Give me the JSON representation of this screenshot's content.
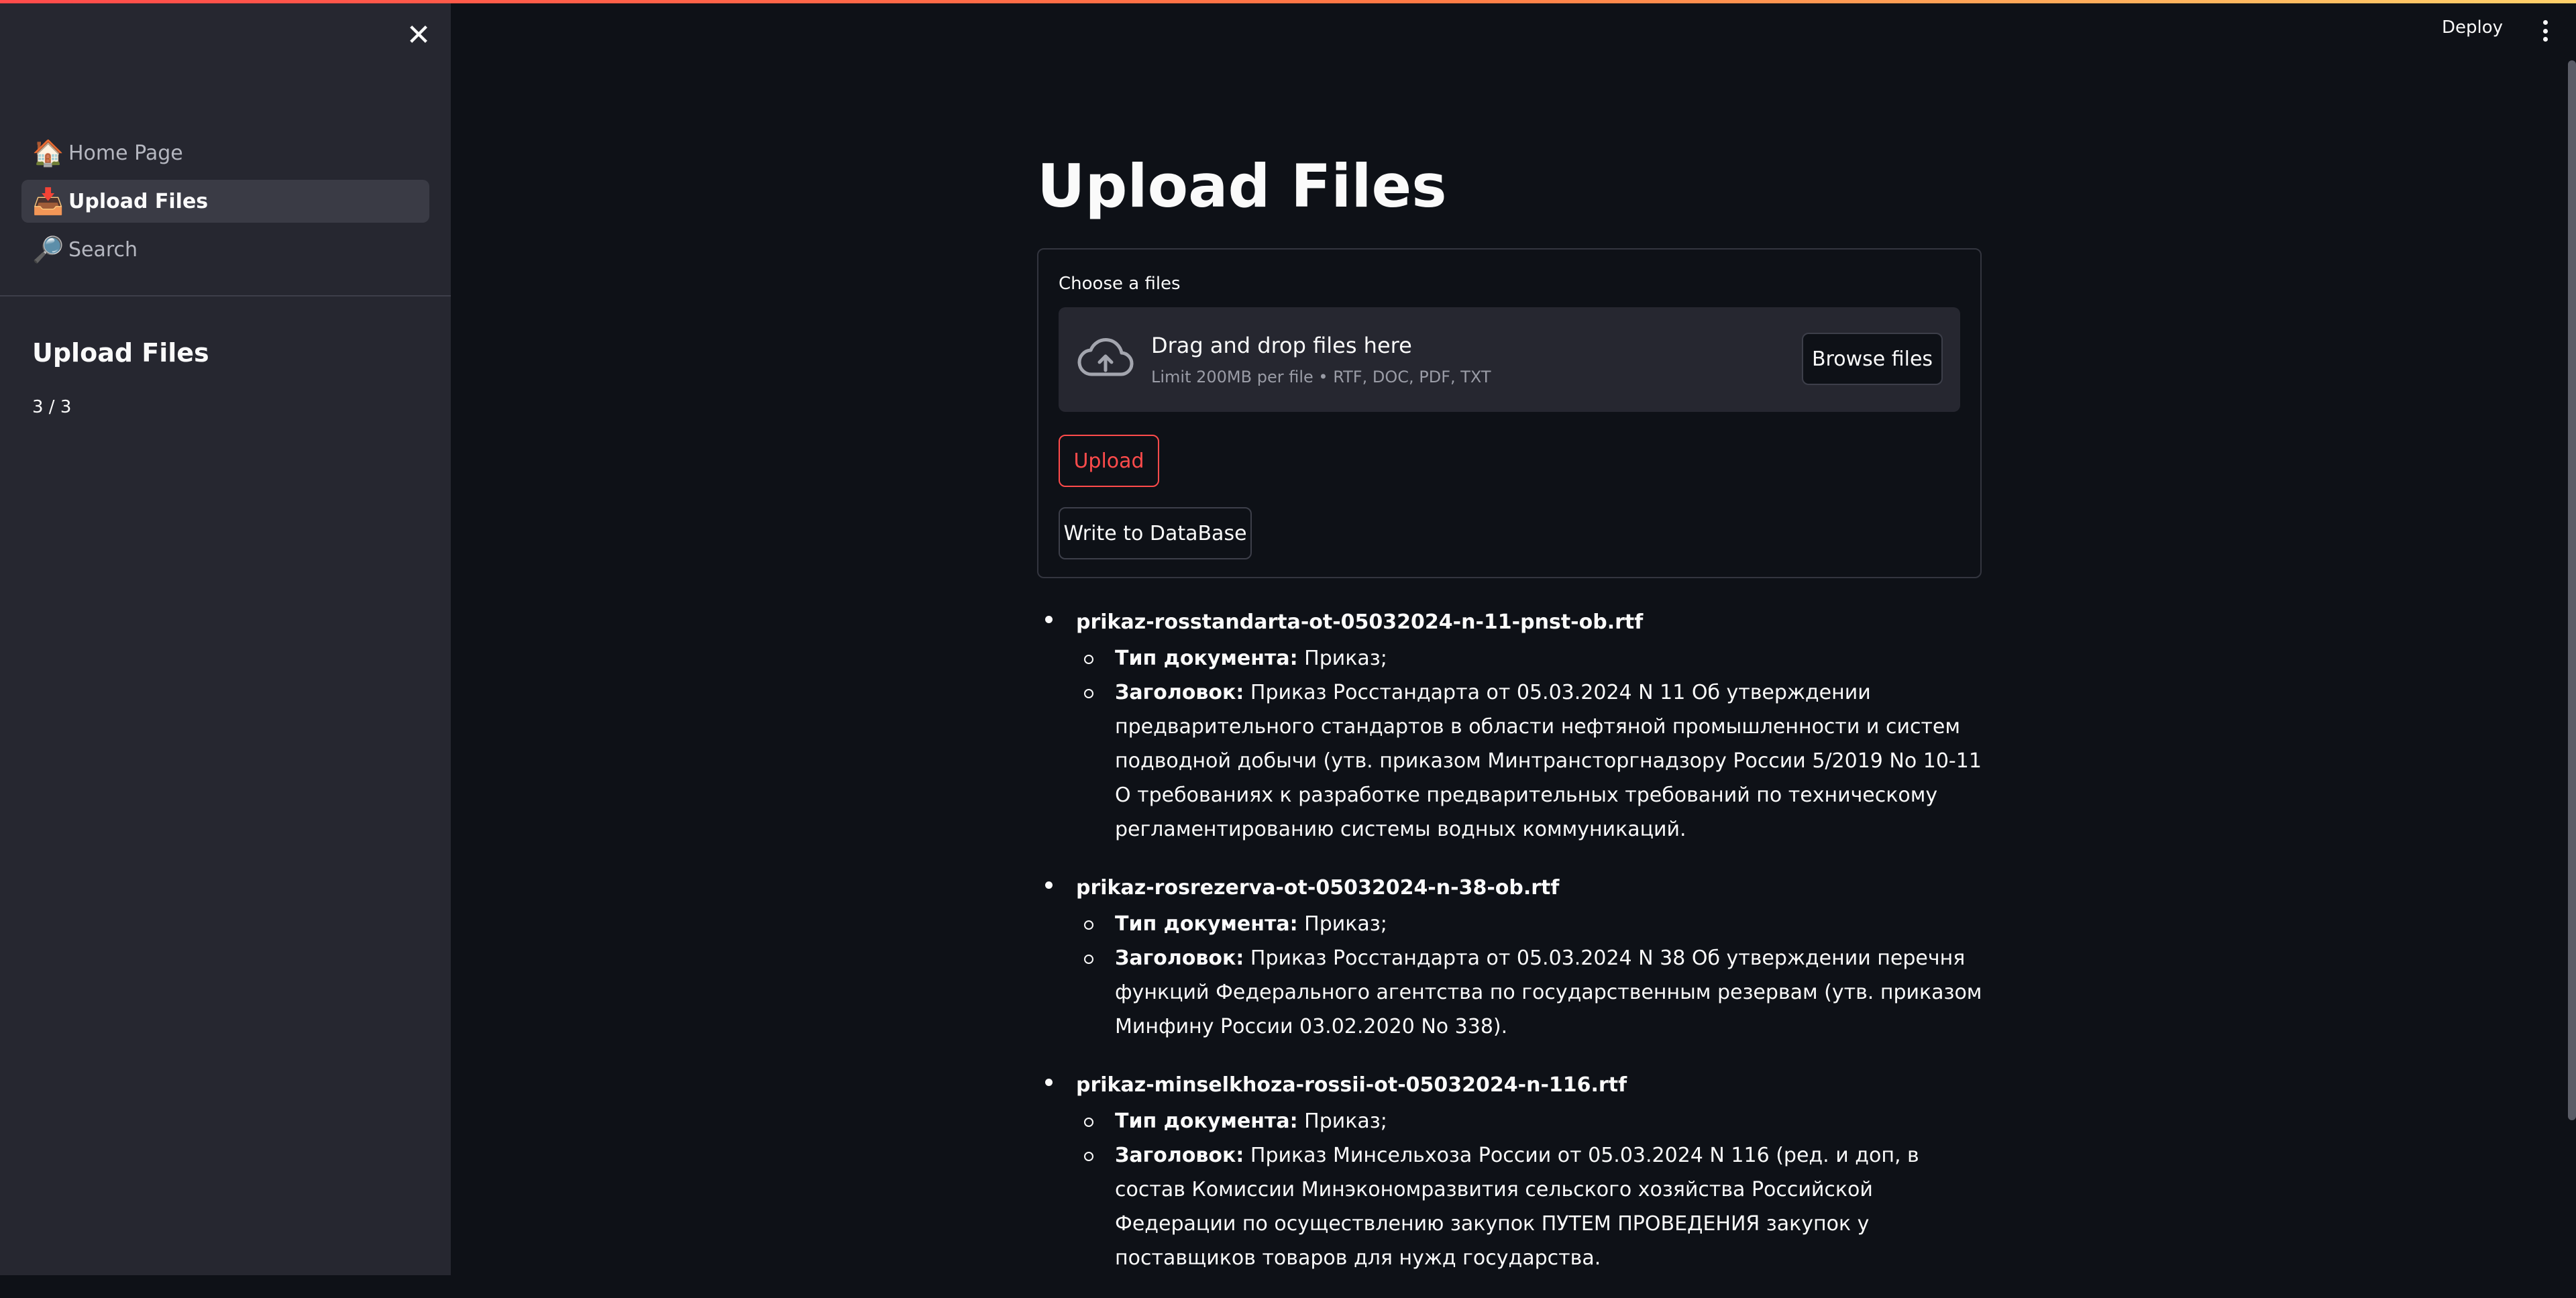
{
  "sidebar": {
    "close_glyph": "✕",
    "nav": [
      {
        "icon": "🏠",
        "label": "Home Page",
        "active": false
      },
      {
        "icon": "📥",
        "label": "Upload Files",
        "active": true
      },
      {
        "icon": "🔎",
        "label": "Search",
        "active": false
      }
    ],
    "section_title": "Upload Files",
    "progress": "3 / 3"
  },
  "header": {
    "deploy_label": "Deploy"
  },
  "main": {
    "title": "Upload Files",
    "uploader": {
      "label": "Choose a files",
      "drop_title": "Drag and drop files here",
      "drop_subtitle": "Limit 200MB per file • RTF, DOC, PDF, TXT",
      "browse_label": "Browse files"
    },
    "upload_button": "Upload",
    "write_button": "Write to DataBase",
    "files": [
      {
        "name": "prikaz-rosstandarta-ot-05032024-n-11-pnst-ob.rtf",
        "type_key": "Тип документа:",
        "type_value": " Приказ;",
        "title_key": "Заголовок:",
        "title_value": " Приказ Росстандарта от 05.03.2024 N 11 Об утверждении предварительного стандартов в области нефтяной промышленности и систем подводной добычи (утв. приказом Минтрансторгнадзору России 5/2019 No 10-11 О требованиях к разработке предварительных требований по техническому регламентированию системы водных коммуникаций."
      },
      {
        "name": "prikaz-rosrezerva-ot-05032024-n-38-ob.rtf",
        "type_key": "Тип документа:",
        "type_value": " Приказ;",
        "title_key": "Заголовок:",
        "title_value": " Приказ Росстандарта от 05.03.2024 N 38 Об утверждении перечня функций Федерального агентства по государственным резервам (утв. приказом Минфину России 03.02.2020 No 338)."
      },
      {
        "name": "prikaz-minselkhoza-rossii-ot-05032024-n-116.rtf",
        "type_key": "Тип документа:",
        "type_value": " Приказ;",
        "title_key": "Заголовок:",
        "title_value": " Приказ Минсельхоза России от 05.03.2024 N 116 (ред. и доп, в состав Комиссии Минэкономразвития сельского хозяйства Российской Федерации по осуществлению закупок ПУТЕМ ПРОВЕДЕНИЯ закупок у поставщиков товаров для нужд государства."
      }
    ]
  },
  "colors": {
    "background": "#0e1117",
    "sidebar": "#262730",
    "accent": "#ff4b4b"
  }
}
